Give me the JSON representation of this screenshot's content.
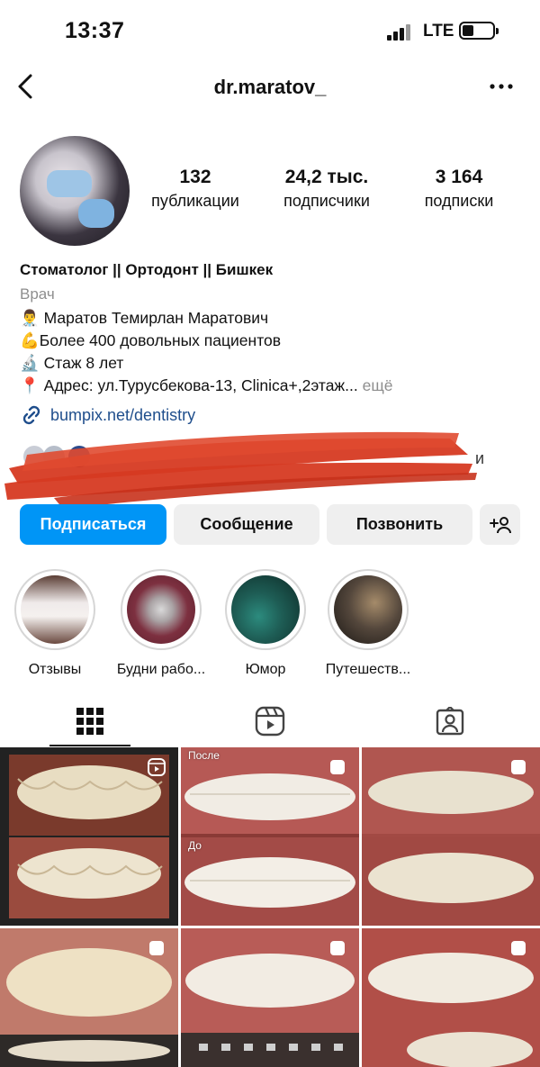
{
  "status_bar": {
    "time": "13:37",
    "network": "LTE"
  },
  "header": {
    "username": "dr.maratov_"
  },
  "profile": {
    "stats": [
      {
        "value": "132",
        "label": "публикации"
      },
      {
        "value": "24,2 тыс.",
        "label": "подписчики"
      },
      {
        "value": "3 164",
        "label": "подписки"
      }
    ],
    "name": "Стоматолог || Ортодонт || Бишкек",
    "category": "Врач",
    "bio_lines": [
      "👨‍⚕️ Маратов Темирлан Маратович",
      "💪Более 400 довольных пациентов",
      "🔬 Стаж 8 лет",
      "📍 Адрес: ул.Турусбекова-13, Clinica+,2этаж..."
    ],
    "bio_more": "ещё",
    "link": "bumpix.net/dentistry"
  },
  "actions": {
    "follow": "Подписаться",
    "message": "Сообщение",
    "call": "Позвонить"
  },
  "highlights": [
    {
      "label": "Отзывы"
    },
    {
      "label": "Будни рабо..."
    },
    {
      "label": "Юмор"
    },
    {
      "label": "Путешеств..."
    }
  ],
  "grid": {
    "captions": {
      "after": "После",
      "before": "До"
    }
  },
  "colors": {
    "accent": "#0095f6",
    "link": "#1f4e8c",
    "redaction": "#d63a22"
  },
  "icons": [
    "back-arrow-icon",
    "more-dots-icon",
    "link-icon",
    "add-person-icon",
    "grid-icon",
    "reels-icon",
    "tagged-icon",
    "multi-post-icon",
    "reel-post-icon"
  ]
}
